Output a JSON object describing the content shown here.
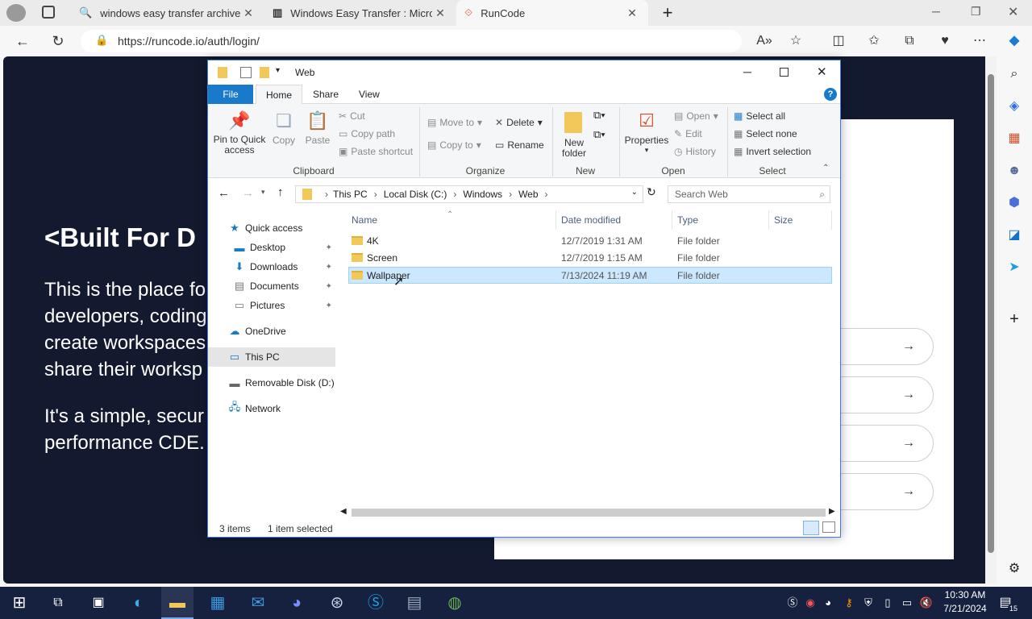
{
  "browser": {
    "tabs": [
      {
        "title": "windows easy transfer archive.o",
        "icon": "search-icon"
      },
      {
        "title": "Windows Easy Transfer : Microso",
        "icon": "archive-icon"
      },
      {
        "title": "RunCode",
        "icon": "runcode-icon"
      }
    ],
    "url": "https://runcode.io/auth/login/",
    "new_tab": "+"
  },
  "page": {
    "hero_title": "<Built For D",
    "hero_p1": [
      "This is the place fo",
      "developers, coding",
      "create workspaces",
      "share their worksp"
    ],
    "hero_p2": [
      "It's a simple, secur",
      "performance CDE."
    ],
    "oauth_arrow": "→"
  },
  "explorer": {
    "title": "Web",
    "tabs": [
      "File",
      "Home",
      "Share",
      "View"
    ],
    "ribbon": {
      "clipboard": {
        "pin": "Pin to Quick access",
        "copy": "Copy",
        "paste": "Paste",
        "cut": "Cut",
        "copy_path": "Copy path",
        "paste_shortcut": "Paste shortcut",
        "group": "Clipboard"
      },
      "organize": {
        "move_to": "Move to",
        "copy_to": "Copy to",
        "delete": "Delete",
        "rename": "Rename",
        "group": "Organize"
      },
      "new": {
        "new_folder": "New folder",
        "group": "New"
      },
      "open": {
        "properties": "Properties",
        "open": "Open",
        "edit": "Edit",
        "history": "History",
        "group": "Open"
      },
      "select": {
        "select_all": "Select all",
        "select_none": "Select none",
        "invert": "Invert selection",
        "group": "Select"
      }
    },
    "breadcrumb": [
      "This PC",
      "Local Disk (C:)",
      "Windows",
      "Web"
    ],
    "search_placeholder": "Search Web",
    "nav": [
      {
        "label": "Quick access",
        "icon": "star-icon"
      },
      {
        "label": "Desktop",
        "icon": "desktop-icon"
      },
      {
        "label": "Downloads",
        "icon": "download-icon"
      },
      {
        "label": "Documents",
        "icon": "document-icon"
      },
      {
        "label": "Pictures",
        "icon": "pictures-icon"
      },
      {
        "label": "OneDrive",
        "icon": "cloud-icon"
      },
      {
        "label": "This PC",
        "icon": "computer-icon"
      },
      {
        "label": "Removable Disk (D:)",
        "icon": "drive-icon"
      },
      {
        "label": "Network",
        "icon": "network-icon"
      }
    ],
    "columns": [
      "Name",
      "Date modified",
      "Type",
      "Size"
    ],
    "files": [
      {
        "name": "4K",
        "date": "12/7/2019 1:31 AM",
        "type": "File folder"
      },
      {
        "name": "Screen",
        "date": "12/7/2019 1:15 AM",
        "type": "File folder"
      },
      {
        "name": "Wallpaper",
        "date": "7/13/2024 11:19 AM",
        "type": "File folder"
      }
    ],
    "status": {
      "count": "3 items",
      "selected": "1 item selected"
    }
  },
  "taskbar": {
    "time": "10:30 AM",
    "date": "7/21/2024",
    "notifications": "15"
  }
}
